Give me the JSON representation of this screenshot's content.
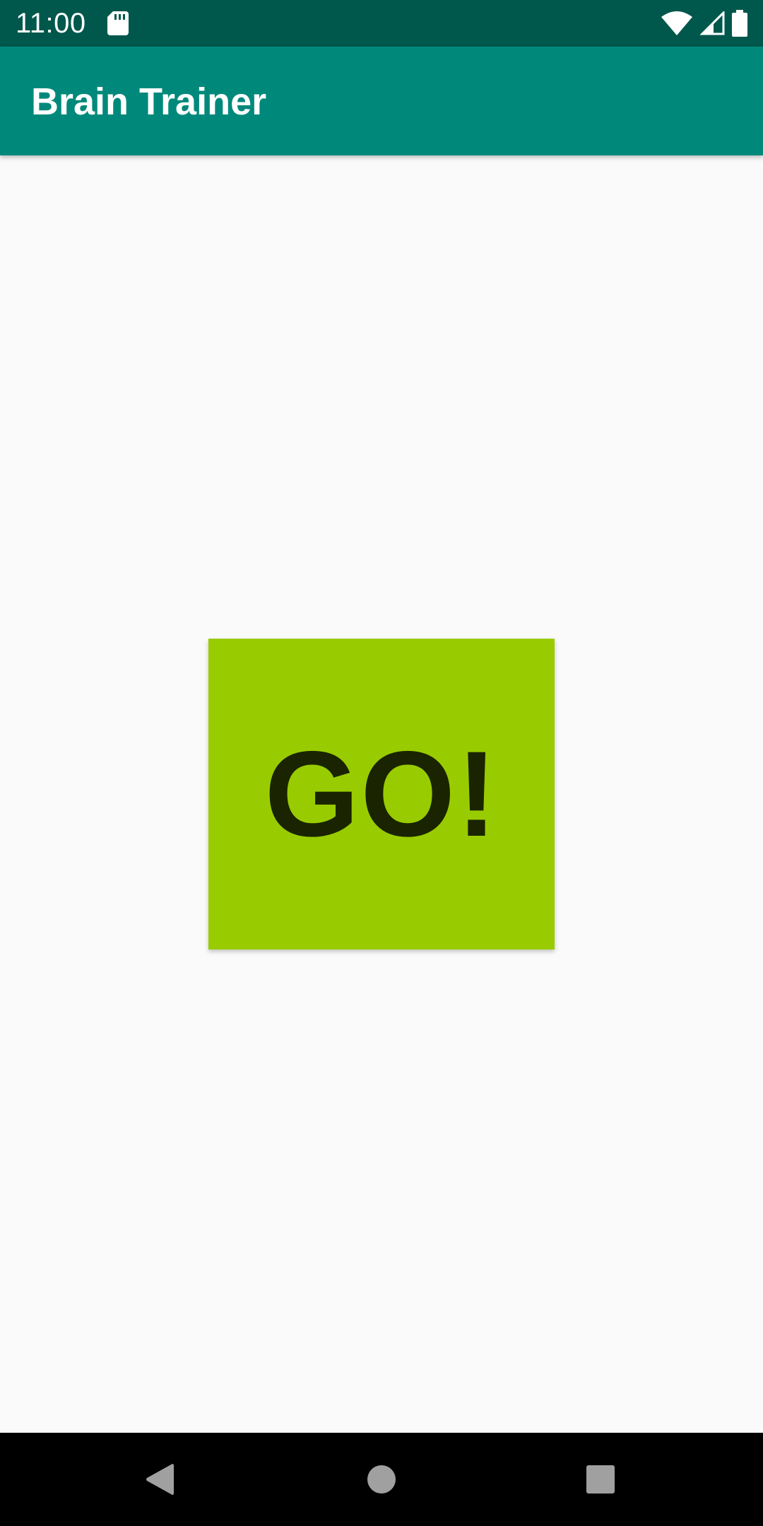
{
  "status_bar": {
    "time": "11:00",
    "icons": [
      "sd-card-icon",
      "wifi-icon",
      "cell-signal-icon",
      "battery-icon"
    ],
    "background": "#00574b"
  },
  "app_bar": {
    "title": "Brain Trainer",
    "background": "#00897b"
  },
  "main": {
    "go_button_label": "GO!",
    "go_button_color": "#99cc00",
    "go_text_color": "#1a2400",
    "background": "#fafafa"
  },
  "nav_bar": {
    "buttons": [
      "back-icon",
      "home-icon",
      "recents-icon"
    ],
    "background": "#000000"
  }
}
